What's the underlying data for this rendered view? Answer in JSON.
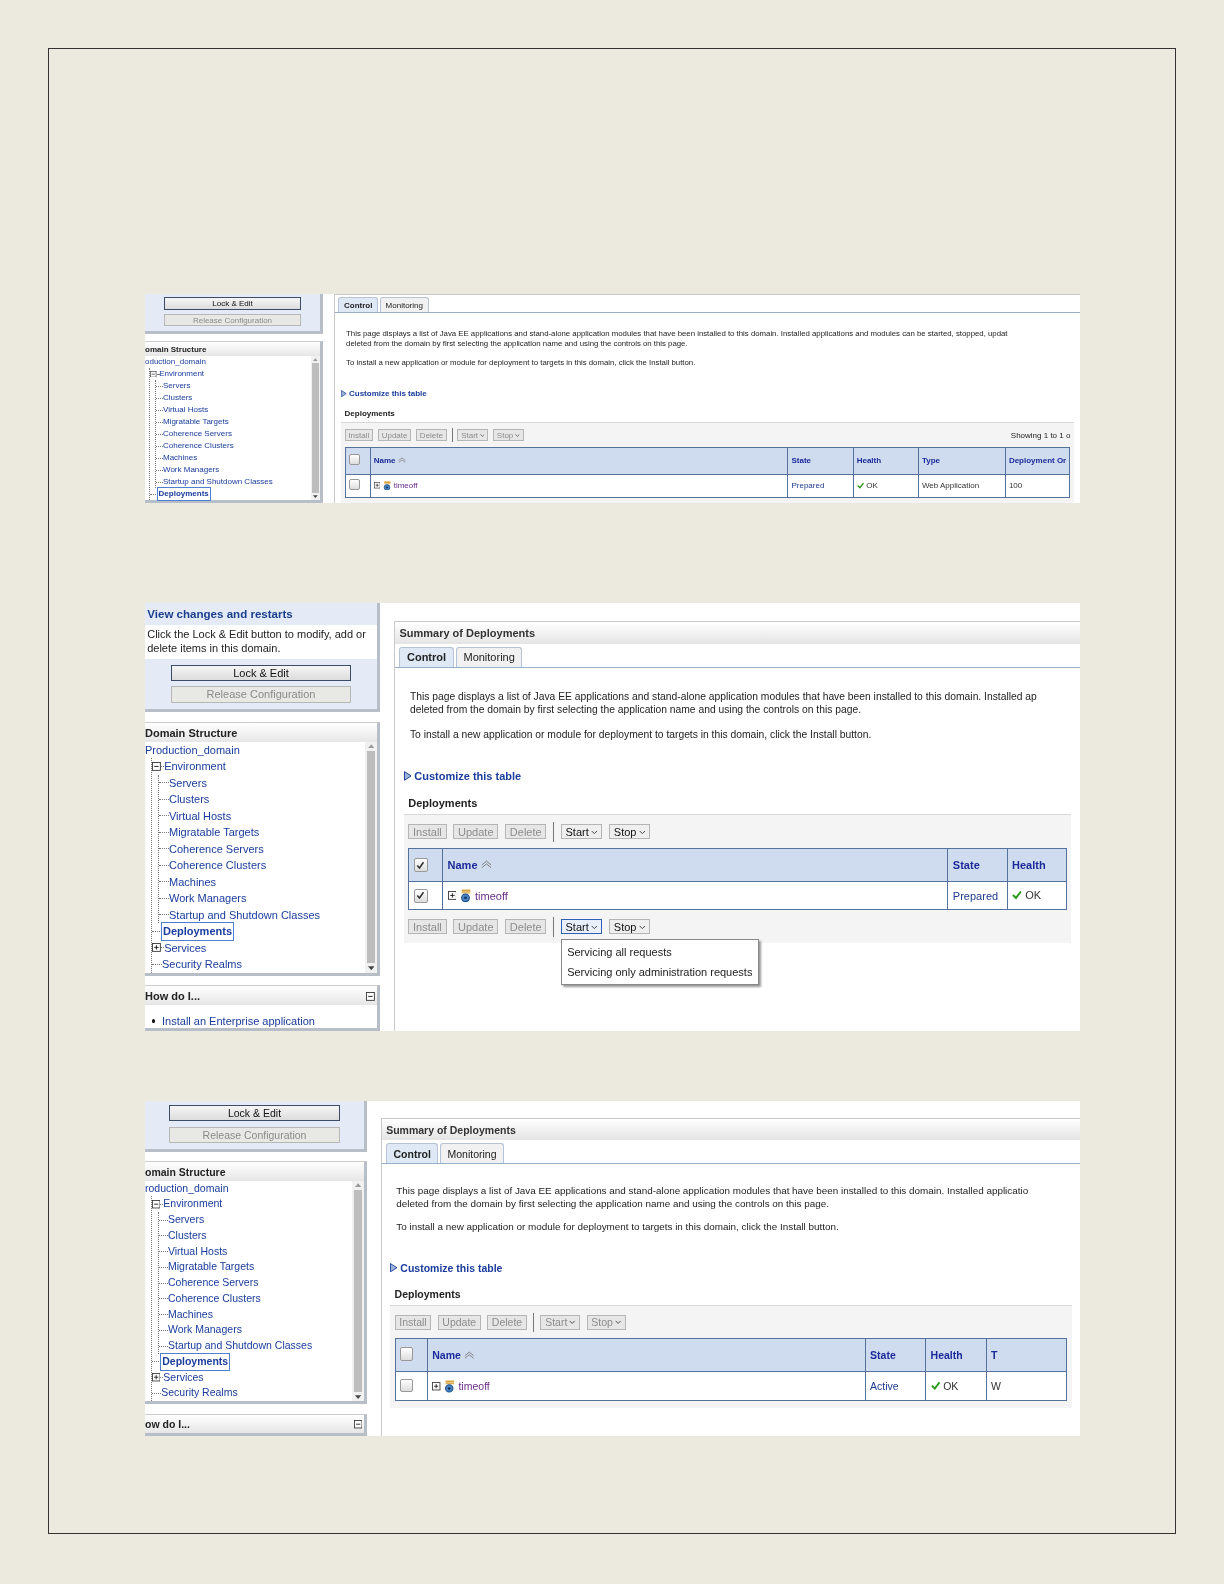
{
  "screenshots": [
    {
      "change_center": {
        "buttons": [
          {
            "label": "Lock & Edit",
            "disabled": false
          },
          {
            "label": "Release Configuration",
            "disabled": true
          }
        ]
      },
      "domain_structure": {
        "title": "omain Structure",
        "tree": [
          {
            "label": "oduction_domain",
            "selected": false,
            "children": [
              {
                "label": "Environment",
                "expanded": true,
                "selected": false,
                "children": [
                  {
                    "label": "Servers",
                    "selected": false
                  },
                  {
                    "label": "Clusters",
                    "selected": false
                  },
                  {
                    "label": "Virtual Hosts",
                    "selected": false
                  },
                  {
                    "label": "Migratable Targets",
                    "selected": false
                  },
                  {
                    "label": "Coherence Servers",
                    "selected": false
                  },
                  {
                    "label": "Coherence Clusters",
                    "selected": false
                  },
                  {
                    "label": "Machines",
                    "selected": false
                  },
                  {
                    "label": "Work Managers",
                    "selected": false
                  },
                  {
                    "label": "Startup and Shutdown Classes",
                    "selected": false
                  }
                ]
              },
              {
                "label": "Deployments",
                "selected": true
              }
            ]
          }
        ]
      },
      "main": {
        "tabs": [
          {
            "label": "Control",
            "selected": true
          },
          {
            "label": "Monitoring",
            "selected": false
          }
        ],
        "description": [
          "This page displays a list of Java EE applications and stand-alone application modules that have been installed to this domain. Installed applications and modules can be started, stopped, updat",
          "deleted from the domain by first selecting the application name and using the controls on this page."
        ],
        "install_hint": "To install a new application or module for deployment to targets in this domain, click the Install button.",
        "customize": "Customize this table",
        "section": "Deployments",
        "toolbar": {
          "buttons": [
            {
              "label": "Install",
              "kind": "plain",
              "disabled": true
            },
            {
              "label": "Update",
              "kind": "plain",
              "disabled": true
            },
            {
              "label": "Delete",
              "kind": "plain",
              "disabled": true
            },
            {
              "label": "Start",
              "kind": "menu",
              "disabled": true,
              "open": false
            },
            {
              "label": "Stop",
              "kind": "menu",
              "disabled": true,
              "open": false
            }
          ],
          "paging": "Showing 1 to 1 o"
        },
        "table": {
          "all_checked": false,
          "columns": [
            {
              "label": "Name",
              "kind": "name"
            },
            {
              "label": "State",
              "kind": "text"
            },
            {
              "label": "Health",
              "kind": "health"
            },
            {
              "label": "Type",
              "kind": "text"
            },
            {
              "label": "Deployment Or",
              "kind": "text"
            }
          ],
          "rows": [
            {
              "checked": false,
              "values": [
                "timeoff",
                "Prepared",
                "OK",
                "Web Application",
                "100"
              ]
            }
          ]
        }
      }
    },
    {
      "change_center": {
        "heading": "View changes and restarts",
        "text": "Click the Lock & Edit button to modify, add or delete items in this domain.",
        "buttons": [
          {
            "label": "Lock & Edit",
            "disabled": false
          },
          {
            "label": "Release Configuration",
            "disabled": true
          }
        ]
      },
      "domain_structure": {
        "title": "Domain Structure",
        "tree": [
          {
            "label": "Production_domain",
            "selected": false,
            "children": [
              {
                "label": "Environment",
                "expanded": true,
                "selected": false,
                "children": [
                  {
                    "label": "Servers",
                    "selected": false
                  },
                  {
                    "label": "Clusters",
                    "selected": false
                  },
                  {
                    "label": "Virtual Hosts",
                    "selected": false
                  },
                  {
                    "label": "Migratable Targets",
                    "selected": false
                  },
                  {
                    "label": "Coherence Servers",
                    "selected": false
                  },
                  {
                    "label": "Coherence Clusters",
                    "selected": false
                  },
                  {
                    "label": "Machines",
                    "selected": false
                  },
                  {
                    "label": "Work Managers",
                    "selected": false
                  },
                  {
                    "label": "Startup and Shutdown Classes",
                    "selected": false
                  }
                ]
              },
              {
                "label": "Deployments",
                "selected": true
              },
              {
                "label": "Services",
                "expanded": false,
                "selected": false
              },
              {
                "label": "Security Realms",
                "selected": false
              }
            ]
          }
        ]
      },
      "how_do_i": {
        "title": "How do I...",
        "links": [
          "Install an Enterprise application"
        ]
      },
      "main": {
        "title": "Summary of Deployments",
        "tabs": [
          {
            "label": "Control",
            "selected": true
          },
          {
            "label": "Monitoring",
            "selected": false
          }
        ],
        "description": [
          "This page displays a list of Java EE applications and stand-alone application modules that have been installed to this domain. Installed ap",
          "deleted from the domain by first selecting the application name and using the controls on this page."
        ],
        "install_hint": "To install a new application or module for deployment to targets in this domain, click the Install button.",
        "customize": "Customize this table",
        "section": "Deployments",
        "toolbar": {
          "buttons": [
            {
              "label": "Install",
              "kind": "plain",
              "disabled": true
            },
            {
              "label": "Update",
              "kind": "plain",
              "disabled": true
            },
            {
              "label": "Delete",
              "kind": "plain",
              "disabled": true
            },
            {
              "label": "Start",
              "kind": "menu",
              "disabled": false,
              "open": false
            },
            {
              "label": "Stop",
              "kind": "menu",
              "disabled": false,
              "open": false
            }
          ]
        },
        "table": {
          "all_checked": true,
          "columns": [
            {
              "label": "Name",
              "kind": "name"
            },
            {
              "label": "State",
              "kind": "text"
            },
            {
              "label": "Health",
              "kind": "health"
            }
          ],
          "rows": [
            {
              "checked": true,
              "values": [
                "timeoff",
                "Prepared",
                "OK"
              ]
            }
          ]
        },
        "toolbar_bottom": {
          "buttons": [
            {
              "label": "Install",
              "kind": "plain",
              "disabled": true
            },
            {
              "label": "Update",
              "kind": "plain",
              "disabled": true
            },
            {
              "label": "Delete",
              "kind": "plain",
              "disabled": true
            },
            {
              "label": "Start",
              "kind": "menu",
              "disabled": false,
              "open": true
            },
            {
              "label": "Stop",
              "kind": "menu",
              "disabled": false,
              "open": false
            }
          ],
          "menu": [
            "Servicing all requests",
            "Servicing only administration requests"
          ]
        }
      }
    },
    {
      "change_center": {
        "buttons": [
          {
            "label": "Lock & Edit",
            "disabled": false
          },
          {
            "label": "Release Configuration",
            "disabled": true
          }
        ]
      },
      "domain_structure": {
        "title": "omain Structure",
        "tree": [
          {
            "label": "roduction_domain",
            "selected": false,
            "children": [
              {
                "label": "Environment",
                "expanded": true,
                "selected": false,
                "children": [
                  {
                    "label": "Servers",
                    "selected": false
                  },
                  {
                    "label": "Clusters",
                    "selected": false
                  },
                  {
                    "label": "Virtual Hosts",
                    "selected": false
                  },
                  {
                    "label": "Migratable Targets",
                    "selected": false
                  },
                  {
                    "label": "Coherence Servers",
                    "selected": false
                  },
                  {
                    "label": "Coherence Clusters",
                    "selected": false
                  },
                  {
                    "label": "Machines",
                    "selected": false
                  },
                  {
                    "label": "Work Managers",
                    "selected": false
                  },
                  {
                    "label": "Startup and Shutdown Classes",
                    "selected": false
                  }
                ]
              },
              {
                "label": "Deployments",
                "selected": true
              },
              {
                "label": "Services",
                "expanded": false,
                "selected": false
              },
              {
                "label": "Security Realms",
                "selected": false
              }
            ]
          }
        ]
      },
      "how_do_i": {
        "title": "ow do I..."
      },
      "main": {
        "title": "Summary of Deployments",
        "tabs": [
          {
            "label": "Control",
            "selected": true
          },
          {
            "label": "Monitoring",
            "selected": false
          }
        ],
        "description": [
          "This page displays a list of Java EE applications and stand-alone application modules that have been installed to this domain. Installed applicatio",
          "deleted from the domain by first selecting the application name and using the controls on this page."
        ],
        "install_hint": "To install a new application or module for deployment to targets in this domain, click the Install button.",
        "customize": "Customize this table",
        "section": "Deployments",
        "toolbar": {
          "buttons": [
            {
              "label": "Install",
              "kind": "plain",
              "disabled": true
            },
            {
              "label": "Update",
              "kind": "plain",
              "disabled": true
            },
            {
              "label": "Delete",
              "kind": "plain",
              "disabled": true
            },
            {
              "label": "Start",
              "kind": "menu",
              "disabled": true,
              "open": false
            },
            {
              "label": "Stop",
              "kind": "menu",
              "disabled": true,
              "open": false
            }
          ]
        },
        "table": {
          "all_checked": false,
          "columns": [
            {
              "label": "Name",
              "kind": "name"
            },
            {
              "label": "State",
              "kind": "text"
            },
            {
              "label": "Health",
              "kind": "health"
            },
            {
              "label": "T",
              "kind": "text"
            }
          ],
          "rows": [
            {
              "checked": false,
              "values": [
                "timeoff",
                "Active",
                "OK",
                "W"
              ]
            }
          ]
        }
      }
    }
  ]
}
